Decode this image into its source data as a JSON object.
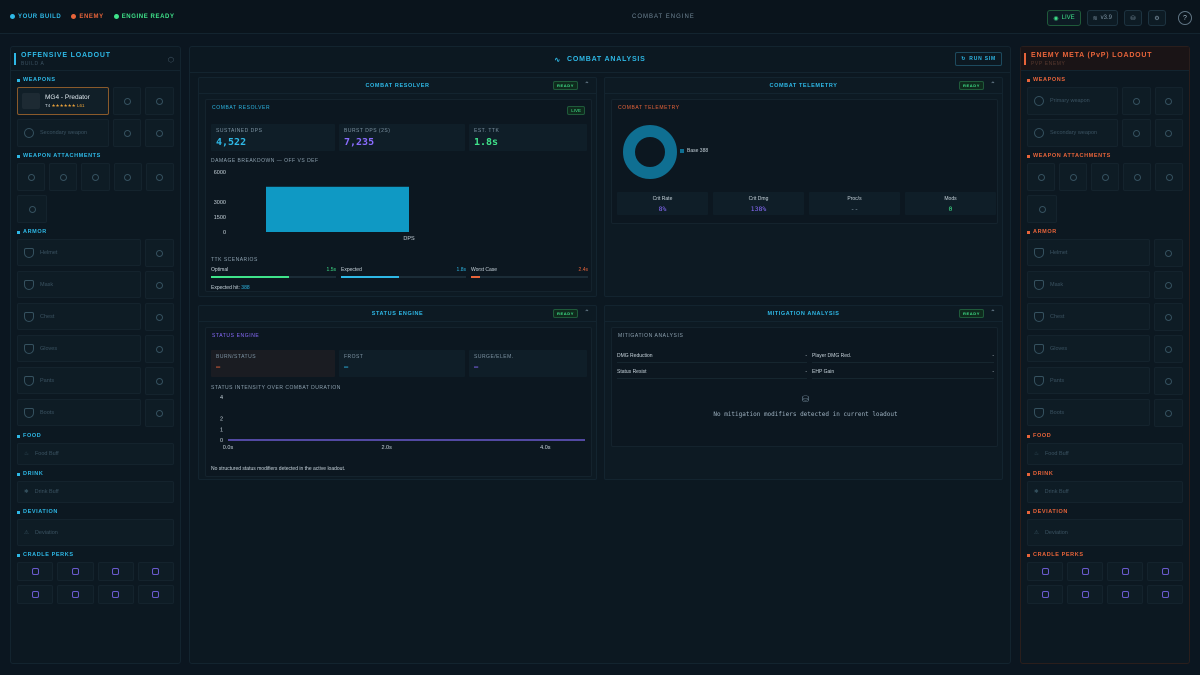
{
  "topbar": {
    "legend": [
      "YOUR BUILD",
      "ENEMY",
      "ENGINE READY"
    ],
    "title": "COMBAT ENGINE",
    "live_label": "LIVE",
    "version": "v3.9",
    "help_glyph": "?"
  },
  "left": {
    "title": "OFFENSIVE LOADOUT",
    "subtitle": "BUILD A",
    "sections": {
      "weapons": "WEAPONS",
      "attachments": "WEAPON ATTACHMENTS",
      "armor": "ARMOR",
      "food": "FOOD",
      "drink": "DRINK",
      "deviation": "DEVIATION",
      "cradle": "CRADLE PERKS"
    },
    "weapon_name": "MG4 - Predator",
    "weapon_tier": "T4",
    "weapon_level": "L61",
    "weapon2": "Secondary weapon",
    "armor_slots": [
      "Helmet",
      "Mask",
      "Chest",
      "Gloves",
      "Pants",
      "Boots"
    ],
    "food": "Food Buff",
    "drink": "Drink Buff",
    "deviation": "Deviation"
  },
  "right": {
    "title": "ENEMY META (PvP) LOADOUT",
    "subtitle": "PVP ENEMY",
    "sections": {
      "weapons": "WEAPONS",
      "attachments": "WEAPON ATTACHMENTS",
      "armor": "ARMOR",
      "food": "FOOD",
      "drink": "DRINK",
      "deviation": "DEVIATION",
      "cradle": "CRADLE PERKS"
    },
    "weapon1": "Primary weapon",
    "weapon2": "Secondary weapon",
    "armor_slots": [
      "Helmet",
      "Mask",
      "Chest",
      "Gloves",
      "Pants",
      "Boots"
    ],
    "food": "Food Buff",
    "drink": "Drink Buff",
    "deviation": "Deviation"
  },
  "center": {
    "title": "COMBAT ANALYSIS",
    "run_sim": "RUN SIM",
    "ready": "READY",
    "resolver": {
      "header": "COMBAT RESOLVER",
      "inner_title": "COMBAT RESOLVER",
      "live": "LIVE",
      "stats": [
        {
          "label": "SUSTAINED DPS",
          "value": "4,522",
          "color": "#2eb8e6"
        },
        {
          "label": "BURST DPS (2S)",
          "value": "7,235",
          "color": "#8a6cff"
        },
        {
          "label": "EST. TTK",
          "value": "1.8s",
          "color": "#3fe38a"
        }
      ],
      "breakdown_label": "DAMAGE BREAKDOWN — OFF VS DEF",
      "ttk_label": "TTK SCENARIOS",
      "ttk": [
        {
          "label": "Optimal",
          "value": "1.5s",
          "fill": 0.62,
          "color": "#3fe38a"
        },
        {
          "label": "Expected",
          "value": "1.8s",
          "fill": 0.46,
          "color": "#2eb8e6"
        },
        {
          "label": "Worst Case",
          "value": "2.4s",
          "fill": 0.08,
          "color": "#e8643a"
        }
      ],
      "expected_hit_label": "Expected hit:",
      "expected_hit_value": "388"
    },
    "telemetry": {
      "header": "COMBAT TELEMETRY",
      "inner_title": "COMBAT TELEMETRY",
      "donut_legend": "Base 388",
      "stats": [
        {
          "label": "Crit Rate",
          "value": "8%",
          "color": "#8a6cff"
        },
        {
          "label": "Crit Dmg",
          "value": "138%",
          "color": "#8a6cff"
        },
        {
          "label": "Proc/s",
          "value": "--",
          "color": "#8ea2b0"
        },
        {
          "label": "Mods",
          "value": "0",
          "color": "#3fe38a"
        }
      ]
    },
    "status": {
      "header": "STATUS ENGINE",
      "inner_title": "STATUS ENGINE",
      "cells": [
        {
          "label": "BURN/STATUS",
          "value": "—",
          "color": "#e8643a"
        },
        {
          "label": "FROST",
          "value": "—",
          "color": "#2eb8e6"
        },
        {
          "label": "SURGE/ELEM.",
          "value": "—",
          "color": "#8a6cff"
        }
      ],
      "intensity_label": "STATUS INTENSITY OVER COMBAT DURATION",
      "note": "No structured status modifiers detected in the active loadout."
    },
    "mitigation": {
      "header": "MITIGATION ANALYSIS",
      "inner_title": "MITIGATION ANALYSIS",
      "rows": [
        {
          "a": "DMG Reduction",
          "av": "-",
          "b": "Player DMG Red.",
          "bv": "-"
        },
        {
          "a": "Status Resist",
          "av": "-",
          "b": "EHP Gain",
          "bv": "-"
        }
      ],
      "empty": "No mitigation modifiers detected in current loadout"
    }
  },
  "chart_data": [
    {
      "type": "bar",
      "categories": [
        "DPS"
      ],
      "values": [
        4522
      ],
      "yticks": [
        "6000",
        "3000",
        "1500",
        "0"
      ],
      "ylim": [
        0,
        6000
      ],
      "color": "#0f99c4"
    },
    {
      "type": "pie",
      "labels": [
        "Base 388"
      ],
      "values": [
        388
      ],
      "color": "#0f6f92"
    },
    {
      "type": "line",
      "x": [
        0,
        4.5
      ],
      "y": [
        0,
        0
      ],
      "xticks": [
        "0.0s",
        "2.0s",
        "4.0s"
      ],
      "yticks": [
        "4",
        "2",
        "1",
        "0"
      ],
      "ylim": [
        0,
        4
      ],
      "color": "#6a5acd"
    }
  ]
}
